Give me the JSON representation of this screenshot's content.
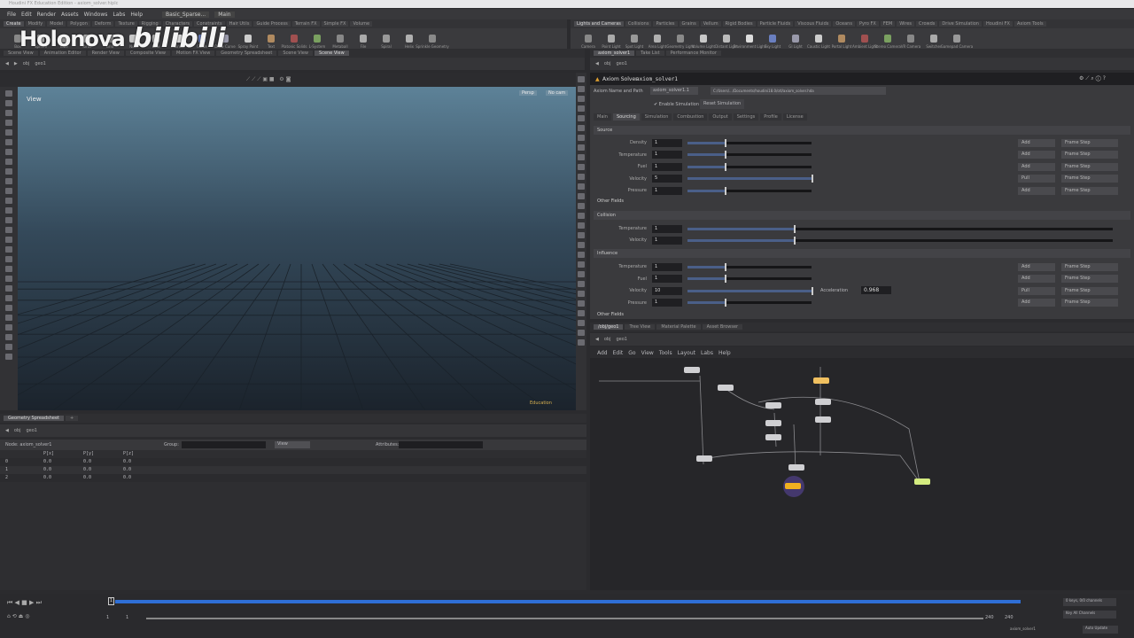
{
  "window": {
    "title": "Houdini FX Education Edition - axiom_solver.hiplc"
  },
  "menu": [
    "File",
    "Edit",
    "Render",
    "Assets",
    "Windows",
    "Labs",
    "Help"
  ],
  "desktop": {
    "label": "Basic_Sparse...",
    "secondary": "Main"
  },
  "shelf_left_tabs": [
    "Create",
    "Modify",
    "Model",
    "Polygon",
    "Deform",
    "Texture",
    "Rigging",
    "Characters",
    "Constraints",
    "Hair Utils",
    "Guide Process",
    "Terrain FX",
    "Simple FX",
    "Volume"
  ],
  "shelf_left_tools": [
    "Box",
    "Sphere",
    "Tube",
    "Torus",
    "Grid",
    "Null",
    "Line",
    "Circle",
    "Curve",
    "Draw Curve",
    "Spray Paint",
    "Text",
    "Platonic Solids",
    "L-System",
    "Metaball",
    "File",
    "Spiral",
    "Helix",
    "Sprinkle Geometry"
  ],
  "shelf_right_tabs": [
    "Lights and Cameras",
    "Collisions",
    "Particles",
    "Grains",
    "Vellum",
    "Rigid Bodies",
    "Particle Fluids",
    "Viscous Fluids",
    "Oceans",
    "Pyro FX",
    "FEM",
    "Wires",
    "Crowds",
    "Drive Simulation",
    "Houdini FX",
    "Axiom Tools"
  ],
  "shelf_right_tools": [
    "Camera",
    "Point Light",
    "Spot Light",
    "Area Light",
    "Geometry Light",
    "Volume Light",
    "Distant Light",
    "Environment Light",
    "Sky Light",
    "GI Light",
    "Caustic Light",
    "Portal Light",
    "Ambient Light",
    "Stereo Camera",
    "VR Camera",
    "Switcher",
    "Gamepad Camera"
  ],
  "left_pane": {
    "tabs": [
      "Scene View",
      "Animation Editor",
      "Render View",
      "Composite View",
      "Motion FX View",
      "Geometry Spreadsheet",
      "Scene View",
      "Scene View"
    ],
    "path": [
      "obj",
      "geo1"
    ],
    "viewport_label": "View",
    "persp": "Persp",
    "cam": "No cam",
    "status": "Education"
  },
  "right_top": {
    "tabs": [
      "axiom_solver1",
      "Take List",
      "Performance Monitor"
    ],
    "path": [
      "obj",
      "geo1"
    ]
  },
  "params": {
    "node_type": "Axiom Solver",
    "node_name": "axiom_solver1",
    "name_path_label": "Axiom Name and Path",
    "name_value": "axiom_solver1.1",
    "path_value": "C:/Users/.../Documents/houdini18.0/otl/axiom_solver.hda",
    "enable_sim": "Enable Simulation",
    "reset_sim": "Reset Simulation",
    "tabs": [
      "Main",
      "Sourcing",
      "Simulation",
      "Combustion",
      "Output",
      "Settings",
      "Profile",
      "License"
    ],
    "source": {
      "title": "Source",
      "rows": [
        {
          "label": "Density",
          "value": "1",
          "fill": 0.3,
          "mode": "Add",
          "step": "Frame Step"
        },
        {
          "label": "Temperature",
          "value": "1",
          "fill": 0.3,
          "mode": "Add",
          "step": "Frame Step"
        },
        {
          "label": "Fuel",
          "value": "1",
          "fill": 0.3,
          "mode": "Add",
          "step": "Frame Step"
        },
        {
          "label": "Velocity",
          "value": "5",
          "fill": 1.0,
          "mode": "Pull",
          "step": "Frame Step"
        },
        {
          "label": "Pressure",
          "value": "1",
          "fill": 0.3,
          "mode": "Add",
          "step": "Frame Step"
        }
      ]
    },
    "other_fields": "Other Fields",
    "collision": {
      "title": "Collision",
      "rows": [
        {
          "label": "Temperature",
          "value": "1",
          "fill": 0.25
        },
        {
          "label": "Velocity",
          "value": "1",
          "fill": 0.25
        }
      ]
    },
    "influence": {
      "title": "Influence",
      "rows": [
        {
          "label": "Temperature",
          "value": "1",
          "fill": 0.3,
          "mode": "Add",
          "step": "Frame Step"
        },
        {
          "label": "Fuel",
          "value": "1",
          "fill": 0.3,
          "mode": "Add",
          "step": "Frame Step"
        },
        {
          "label": "Velocity",
          "value": "10",
          "fill": 1.0,
          "mode": "Pull",
          "step": "Frame Step"
        },
        {
          "label": "Pressure",
          "value": "1",
          "fill": 0.3,
          "mode": "Add",
          "step": "Frame Step"
        }
      ],
      "accel_label": "Acceleration",
      "accel_value": "0.968"
    },
    "other_fields2": "Other Fields"
  },
  "network": {
    "tabs": [
      "/obj/geo1",
      "Tree View",
      "Material Palette",
      "Asset Browser"
    ],
    "path": [
      "obj",
      "geo1"
    ],
    "menu": [
      "Add",
      "Edit",
      "Go",
      "View",
      "Tools",
      "Layout",
      "Labs",
      "Help"
    ]
  },
  "spreadsheet": {
    "tab": "Geometry Spreadsheet",
    "path": [
      "obj",
      "geo1"
    ],
    "node_label": "Node: axiom_solver1",
    "group_label": "Group:",
    "view_label": "View",
    "attributes_label": "Attributes:",
    "columns": [
      "",
      "P[x]",
      "P[y]",
      "P[z]"
    ],
    "rows": [
      [
        "0",
        "0.0",
        "0.0",
        "0.0"
      ],
      [
        "1",
        "0.0",
        "0.0",
        "0.0"
      ],
      [
        "2",
        "0.0",
        "0.0",
        "0.0"
      ]
    ]
  },
  "timeline": {
    "current_frame": "1",
    "start": "1",
    "start2": "1",
    "end": "240",
    "end2": "240",
    "keys_label": "0 keys, 0/0 channels",
    "key_all": "Key All Channels",
    "auto_update": "Auto Update",
    "user": "axiom_solver1"
  },
  "watermark": {
    "text1": "Holonova",
    "text2": "bilibili"
  },
  "colors": {
    "accent_blue": "#2f6fd6",
    "viewport_top": "#5d8298",
    "selected_node": "#f0b020",
    "display_node": "#c8e870"
  }
}
